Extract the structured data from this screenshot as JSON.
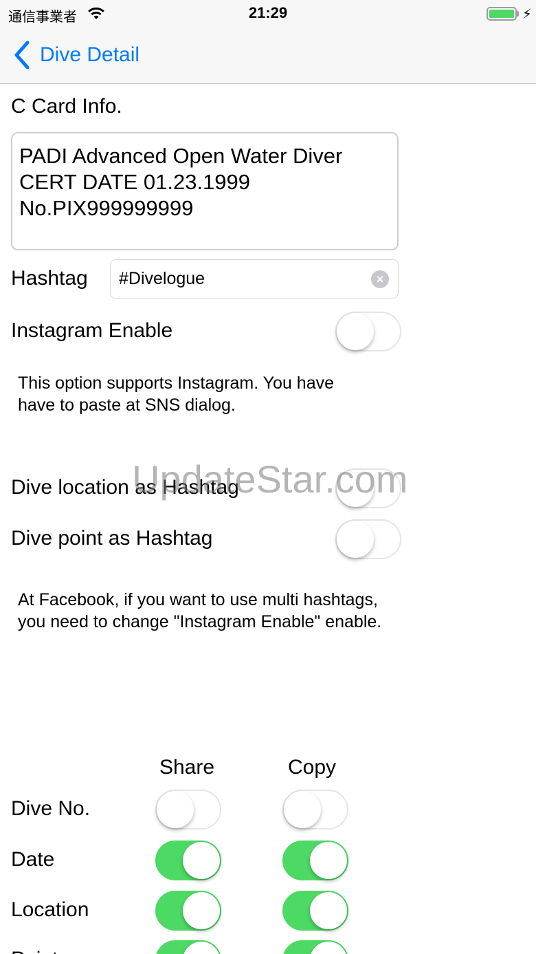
{
  "status_bar": {
    "carrier": "通信事業者",
    "time": "21:29",
    "wifi_icon": "wifi-icon",
    "battery_icon": "battery-icon",
    "charging_icon": "bolt-icon",
    "battery_level": 1.0
  },
  "nav": {
    "back_label": "Dive Detail",
    "back_icon": "chevron-left-icon",
    "accent_color": "#007aff"
  },
  "ccard": {
    "label": "C Card Info.",
    "lines": [
      "PADI Advanced Open Water Diver",
      "CERT DATE 01.23.1999",
      "No.PIX999999999"
    ]
  },
  "hashtag": {
    "label": "Hashtag",
    "value": "#Divelogue",
    "clear_icon": "clear-icon"
  },
  "instagram": {
    "label": "Instagram Enable",
    "on": false,
    "note": "This option supports Instagram. You have have to paste at  SNS dialog."
  },
  "dive_location_hashtag": {
    "label": "Dive location as Hashtag",
    "on": false
  },
  "dive_point_hashtag": {
    "label": "Dive point as Hashtag",
    "on": false
  },
  "facebook_note": "At Facebook, if you want to use multi hashtags, you need to change \"Instagram Enable\" enable.",
  "table": {
    "headers": [
      "Share",
      "Copy"
    ],
    "rows": [
      {
        "label": "Dive No.",
        "share": false,
        "copy": false
      },
      {
        "label": "Date",
        "share": true,
        "copy": true
      },
      {
        "label": "Location",
        "share": true,
        "copy": true
      },
      {
        "label": "Point",
        "share": true,
        "copy": true
      }
    ]
  },
  "watermark": "UpdateStar.com",
  "colors": {
    "switch_on": "#4cd964",
    "switch_off_border": "#e5e5ea"
  }
}
